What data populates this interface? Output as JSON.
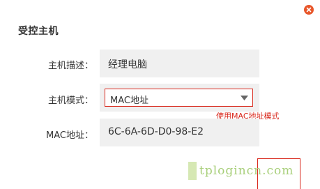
{
  "dialog": {
    "title": "受控主机",
    "close_icon": "close-icon"
  },
  "form": {
    "host_desc": {
      "label": "主机描述：",
      "value": "经理电脑"
    },
    "host_mode": {
      "label": "主机模式：",
      "selected": "MAC地址",
      "hint": "使用MAC地址模式"
    },
    "mac": {
      "label": "MAC地址：",
      "value": "6C-6A-6D-D0-98-E2"
    }
  },
  "watermark": {
    "text": "tplogincn.com"
  },
  "colors": {
    "accent_red": "#d9281c",
    "close_orange": "#e8562a",
    "field_bg": "#f0f0f0",
    "watermark_green": "#a8cf7a"
  }
}
